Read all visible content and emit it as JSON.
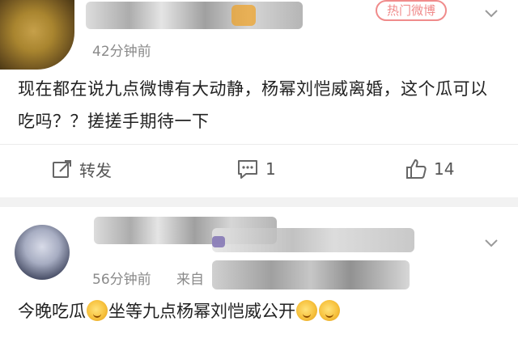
{
  "comments": [
    {
      "time": "42分钟前",
      "badge": "热门微博",
      "text": "现在都在说九点微博有大动静，杨幂刘恺威离婚，这个瓜可以吃吗？？搓搓手期待一下",
      "actions": {
        "repost_label": "转发",
        "comment_count": "1",
        "like_count": "14"
      }
    },
    {
      "time": "56分钟前",
      "from_label": "来自",
      "text_parts": [
        "今晚吃瓜",
        "坐等九点杨幂刘恺威公开"
      ]
    }
  ],
  "colors": {
    "separator": "#f2f2f2",
    "badge": "#f08b8b",
    "meta_text": "#8a8a8a"
  },
  "icons": [
    "chevron-down-icon",
    "repost-icon",
    "comment-icon",
    "like-icon",
    "emoji-icon"
  ]
}
